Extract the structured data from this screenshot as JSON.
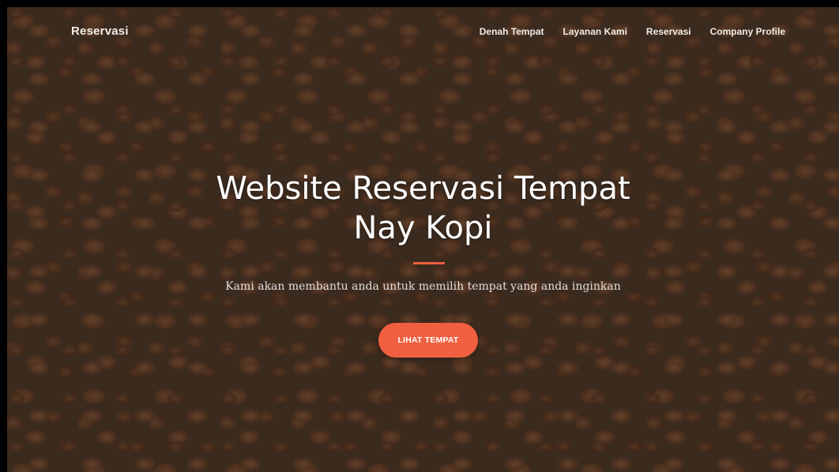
{
  "navbar": {
    "brand": "Reservasi",
    "links": [
      {
        "label": "Denah Tempat"
      },
      {
        "label": "Layanan Kami"
      },
      {
        "label": "Reservasi"
      },
      {
        "label": "Company Profile"
      }
    ]
  },
  "hero": {
    "title_line1": "Website Reservasi Tempat",
    "title_line2": "Nay Kopi",
    "subtitle": "Kami akan membantu anda untuk memilih tempat yang anda inginkan",
    "cta_label": "LIHAT TEMPAT"
  },
  "colors": {
    "accent": "#f05f40",
    "overlay": "#3c2a1e",
    "text": "#ffffff"
  },
  "background": {
    "image": "coffee-beans-photo"
  }
}
